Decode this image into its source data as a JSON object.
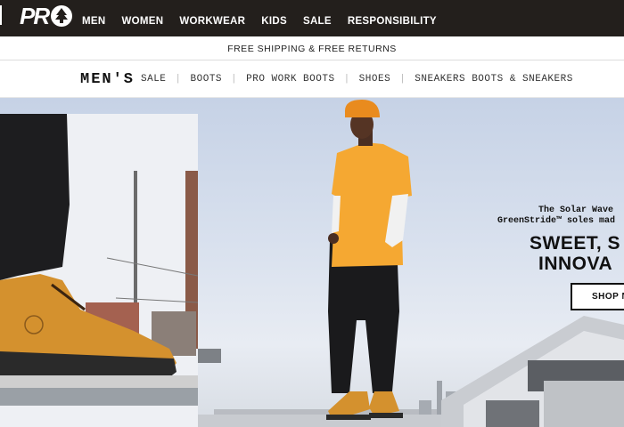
{
  "brand": {
    "logo_text": "PR",
    "logo_icon": "tree-icon"
  },
  "nav": {
    "items": [
      "MEN",
      "WOMEN",
      "WORKWEAR",
      "KIDS",
      "SALE",
      "RESPONSIBILITY"
    ]
  },
  "promo": {
    "text": "FREE SHIPPING & FREE RETURNS"
  },
  "subnav": {
    "title": "MEN'S",
    "links": [
      "SALE",
      "BOOTS",
      "PRO WORK BOOTS",
      "SHOES",
      "SNEAKERS BOOTS & SNEAKERS"
    ]
  },
  "hero": {
    "sub_line1": "The Solar Wave",
    "sub_line2": "GreenStride™ soles mad",
    "headline_line1": "SWEET, S",
    "headline_line2": "INNOVA",
    "button_label": "SHOP N"
  },
  "colors": {
    "topbar": "#231f1c",
    "boot": "#d4912e",
    "shirt": "#f5a832",
    "sky": "#c6d2e6"
  }
}
